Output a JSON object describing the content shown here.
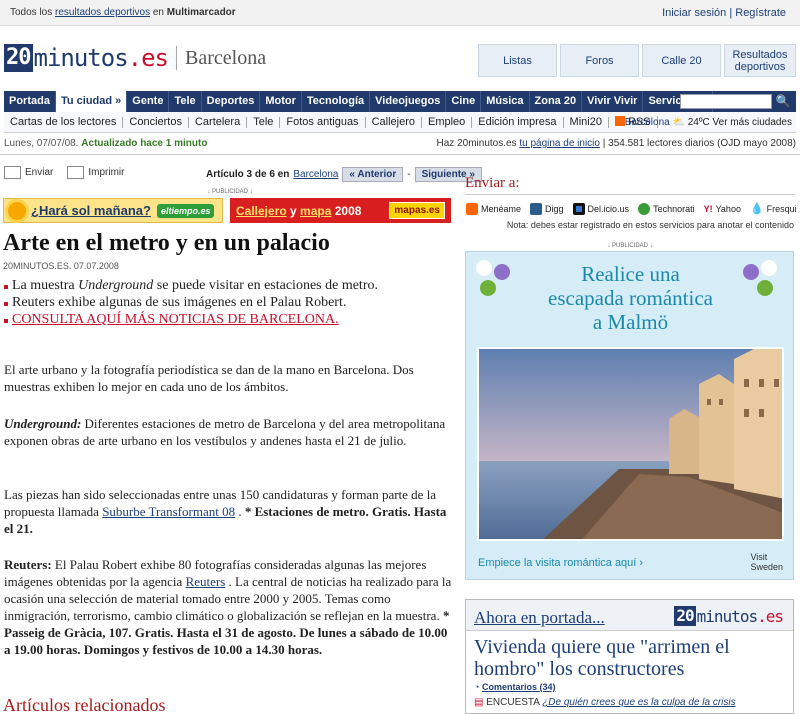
{
  "top": {
    "prefix": "Todos los",
    "link": "resultados deportivos",
    "mid": "en",
    "brand": "Multimarcador",
    "login": "Iniciar sesión",
    "sep": " | ",
    "register": "Regístrate"
  },
  "header": {
    "logo_num": "20",
    "logo_word": "minutos",
    "logo_tld": ".es",
    "city": "Barcelona",
    "buttons": [
      "Listas",
      "Foros",
      "Calle 20",
      "Resultados deportivos"
    ]
  },
  "nav": {
    "items": [
      "Portada",
      "Tu ciudad »",
      "Gente",
      "Tele",
      "Deportes",
      "Motor",
      "Tecnología",
      "Videojuegos",
      "Cine",
      "Música",
      "Zona 20",
      "Vivir Vivir",
      "Servicios »"
    ]
  },
  "subnav": {
    "items": [
      "Cartas de los lectores",
      "Conciertos",
      "Cartelera",
      "Tele",
      "Fotos antiguas",
      "Callejero",
      "Empleo",
      "Edición impresa",
      "Mini20",
      "RSS"
    ],
    "weather_city": "Barcelona",
    "weather_temp": "24ºC Ver más ciudades"
  },
  "status": {
    "date": "Lunes, 07/07/08.",
    "updated": "Actualizado hace 1 minuto",
    "right_pre": "Haz 20minutos.es",
    "right_link": "tu página de inicio",
    "right_post": "| 354.581 lectores diarios (OJD mayo 2008)"
  },
  "toolbar": {
    "send": "Enviar",
    "print": "Imprimir",
    "article_pos": "Artículo 3 de 6 en",
    "section": "Barcelona",
    "prev": "« Anterior",
    "dash": "-",
    "next": "Siguiente »"
  },
  "ads": {
    "label": "↓ PUBLICIDAD ↓",
    "weather_q": "¿Hará sol mañana?",
    "weather_tag": "eltiempo.es",
    "maps_a": "Callejero",
    "maps_y": " y ",
    "maps_b": "mapa",
    "maps_year": " 2008",
    "maps_tag": "mapas.es"
  },
  "article": {
    "title": "Arte en el metro y en un palacio",
    "byline": "20MINUTOS.ES. 07.07.2008",
    "bullet1_pre": "La muestra ",
    "bullet1_em": "Underground",
    "bullet1_post": " se puede visitar en estaciones de metro.",
    "bullet2": "Reuters exhibe algunas de sus imágenes en el Palau Robert.",
    "bullet3": "CONSULTA AQUÍ MÁS NOTICIAS DE BARCELONA.",
    "p1": "El arte urbano y la fotografía periodística se dan de la mano en Barcelona. Dos muestras exhiben lo mejor en cada uno de los ámbitos.",
    "p2_em": "Underground:",
    "p2": " Diferentes estaciones de metro de Barcelona y del area metropolitana exponen obras de arte urbano en los vestíbulos y andenes hasta el 21 de julio.",
    "p3_pre": "Las piezas han sido seleccionadas entre unas 150 candidaturas y forman parte de la propuesta llamada ",
    "p3_link": "Suburbe Transformant 08",
    "p3_mid": " . ",
    "p3_bold": "* Estaciones de metro. Gratis. Hasta el 21.",
    "p4_lead": "Reuters:",
    "p4_pre": " El Palau Robert exhibe 80 fotografías consideradas algunas las mejores imágenes obtenidas por la agencia ",
    "p4_link": "Reuters",
    "p4_post": " . La central de noticias ha realizado para la ocasión una selección de material tomado entre 2000 y 2005. Temas como inmigración, terrorismo, cambio climático o globalización se reflejan en la muestra. ",
    "p4_bold": "* Passeig de Gràcia, 107. Gratis. Hasta el 31 de agosto. De lunes a sábado de 10.00 a 19.00 horas. Domingos y festivos de 10.00 a 14.30 horas.",
    "related": "Artículos relacionados"
  },
  "side": {
    "send_title": "Enviar a:",
    "share": [
      "Menéame",
      "Digg",
      "Del.icio.us",
      "Technorati",
      "Yahoo",
      "Fresqui"
    ],
    "note": "Nota: debes estar registrado en estos servicios para anotar el contenido",
    "ad_label": "↓ PUBLICIDAD ↓",
    "ad_l1": "Realice una",
    "ad_l2": "escapada romántica",
    "ad_l3": "a Malmö",
    "ad_footer": "Empiece la visita romántica aquí ›",
    "ad_visit1": "Visit",
    "ad_visit2": "Sweden",
    "now_title": "Ahora en portada...",
    "now_head": "Vivienda quiere que \"arrimen el hombro\" los constructores",
    "now_comments": "Comentarios (34)",
    "now_enc_label": "ENCUESTA",
    "now_enc_link": "¿De quién crees que es la culpa de la crisis"
  },
  "colors": {
    "brand": "#1f3a6b",
    "accent": "#c8102e",
    "section_title": "#a41d1d"
  }
}
